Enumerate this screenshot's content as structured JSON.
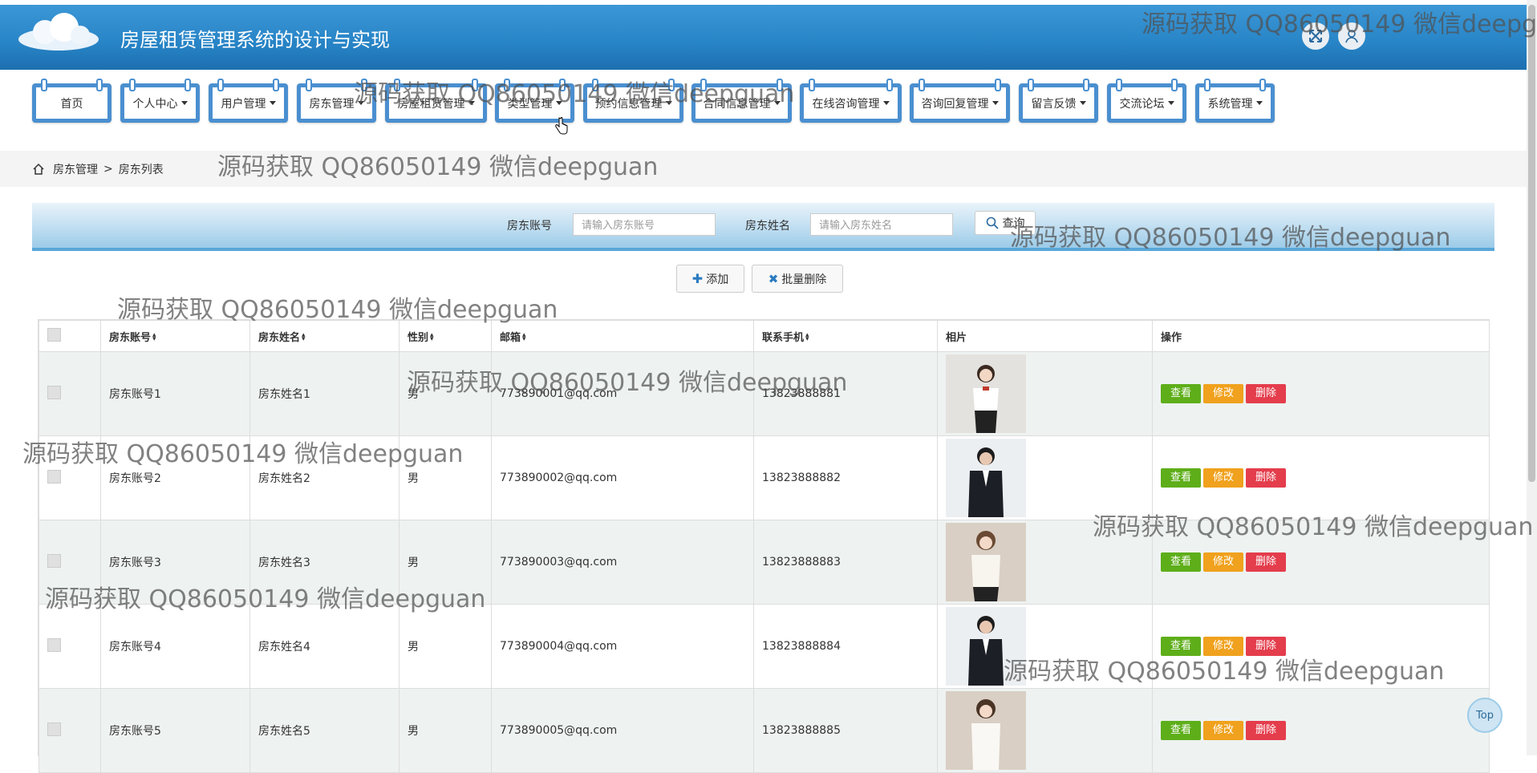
{
  "app": {
    "title": "房屋租赁管理系统的设计与实现"
  },
  "nav": [
    {
      "label": "首页",
      "dropdown": false
    },
    {
      "label": "个人中心",
      "dropdown": true
    },
    {
      "label": "用户管理",
      "dropdown": true
    },
    {
      "label": "房东管理",
      "dropdown": true
    },
    {
      "label": "房屋租赁管理",
      "dropdown": true
    },
    {
      "label": "类型管理",
      "dropdown": true
    },
    {
      "label": "预约信息管理",
      "dropdown": true
    },
    {
      "label": "合同信息管理",
      "dropdown": true
    },
    {
      "label": "在线咨询管理",
      "dropdown": true
    },
    {
      "label": "咨询回复管理",
      "dropdown": true
    },
    {
      "label": "留言反馈",
      "dropdown": true
    },
    {
      "label": "交流论坛",
      "dropdown": true
    },
    {
      "label": "系统管理",
      "dropdown": true
    }
  ],
  "breadcrumb": {
    "parent": "房东管理",
    "separator": ">",
    "current": "房东列表"
  },
  "search": {
    "account_label": "房东账号",
    "account_placeholder": "请输入房东账号",
    "name_label": "房东姓名",
    "name_placeholder": "请输入房东姓名",
    "query_label": "查询"
  },
  "actions": {
    "add": "添加",
    "batch_delete": "批量删除"
  },
  "table": {
    "headers": [
      "房东账号",
      "房东姓名",
      "性别",
      "邮箱",
      "联系手机",
      "相片",
      "操作"
    ],
    "rows": [
      {
        "account": "房东账号1",
        "name": "房东姓名1",
        "gender": "男",
        "email": "773890001@qq.com",
        "phone": "13823888881"
      },
      {
        "account": "房东账号2",
        "name": "房东姓名2",
        "gender": "男",
        "email": "773890002@qq.com",
        "phone": "13823888882"
      },
      {
        "account": "房东账号3",
        "name": "房东姓名3",
        "gender": "男",
        "email": "773890003@qq.com",
        "phone": "13823888883"
      },
      {
        "account": "房东账号4",
        "name": "房东姓名4",
        "gender": "男",
        "email": "773890004@qq.com",
        "phone": "13823888884"
      },
      {
        "account": "房东账号5",
        "name": "房东姓名5",
        "gender": "男",
        "email": "773890005@qq.com",
        "phone": "13823888885"
      }
    ],
    "row_actions": {
      "view": "查看",
      "edit": "修改",
      "delete": "删除"
    }
  },
  "top_button": "Top",
  "watermark": "源码获取 QQ86050149 微信deepguan",
  "colors": {
    "header_blue": "#2784c6",
    "view_green": "#5eae1a",
    "edit_orange": "#f0a11d",
    "delete_red": "#e43d4c"
  }
}
